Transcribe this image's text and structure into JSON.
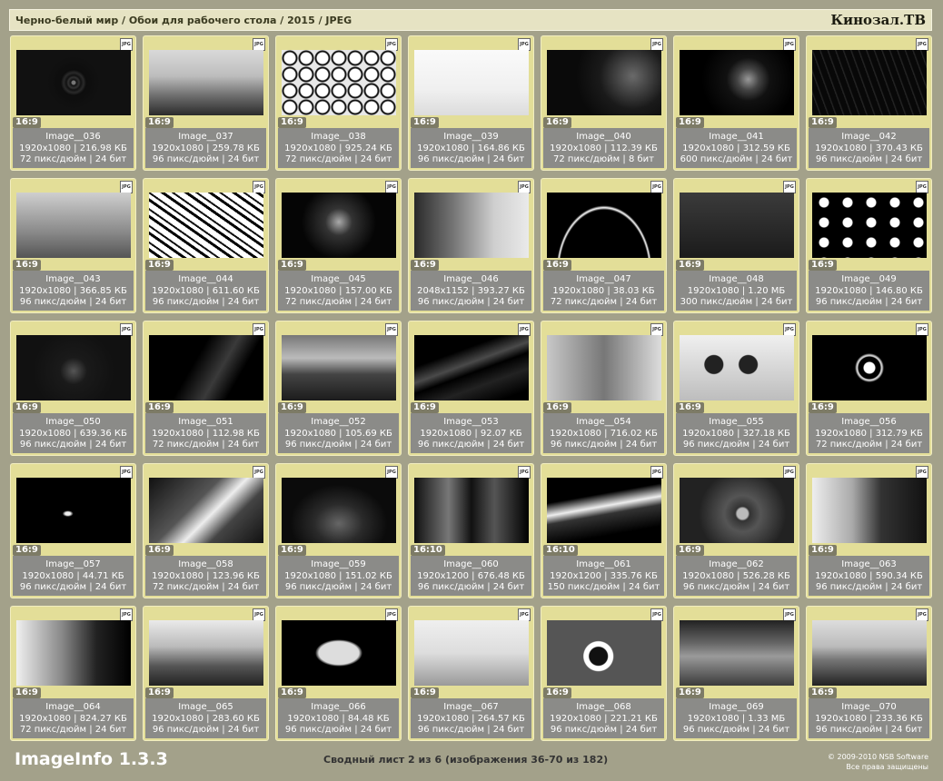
{
  "header": {
    "breadcrumb": "Черно-белый мир / Обои для рабочего стола / 2015 / JPEG",
    "site": "Кинозал.ТВ"
  },
  "badge": "JPG",
  "items": [
    {
      "name": "Image__036",
      "res": "1920x1080",
      "size": "216.98 КБ",
      "dpi": "72 пикс/дюйм",
      "bits": "24 бит",
      "ratio": "16:9"
    },
    {
      "name": "Image__037",
      "res": "1920x1080",
      "size": "259.78 КБ",
      "dpi": "96 пикс/дюйм",
      "bits": "24 бит",
      "ratio": "16:9"
    },
    {
      "name": "Image__038",
      "res": "1920x1080",
      "size": "925.24 КБ",
      "dpi": "72 пикс/дюйм",
      "bits": "24 бит",
      "ratio": "16:9"
    },
    {
      "name": "Image__039",
      "res": "1920x1080",
      "size": "164.86 КБ",
      "dpi": "96 пикс/дюйм",
      "bits": "24 бит",
      "ratio": "16:9"
    },
    {
      "name": "Image__040",
      "res": "1920x1080",
      "size": "112.39 КБ",
      "dpi": "72 пикс/дюйм",
      "bits": "8 бит",
      "ratio": "16:9"
    },
    {
      "name": "Image__041",
      "res": "1920x1080",
      "size": "312.59 КБ",
      "dpi": "600 пикс/дюйм",
      "bits": "24 бит",
      "ratio": "16:9"
    },
    {
      "name": "Image__042",
      "res": "1920x1080",
      "size": "370.43 КБ",
      "dpi": "96 пикс/дюйм",
      "bits": "24 бит",
      "ratio": "16:9"
    },
    {
      "name": "Image__043",
      "res": "1920x1080",
      "size": "366.85 КБ",
      "dpi": "96 пикс/дюйм",
      "bits": "24 бит",
      "ratio": "16:9"
    },
    {
      "name": "Image__044",
      "res": "1920x1080",
      "size": "611.60 КБ",
      "dpi": "96 пикс/дюйм",
      "bits": "24 бит",
      "ratio": "16:9"
    },
    {
      "name": "Image__045",
      "res": "1920x1080",
      "size": "157.00 КБ",
      "dpi": "72 пикс/дюйм",
      "bits": "24 бит",
      "ratio": "16:9"
    },
    {
      "name": "Image__046",
      "res": "2048x1152",
      "size": "393.27 КБ",
      "dpi": "96 пикс/дюйм",
      "bits": "24 бит",
      "ratio": "16:9"
    },
    {
      "name": "Image__047",
      "res": "1920x1080",
      "size": "38.03 КБ",
      "dpi": "72 пикс/дюйм",
      "bits": "24 бит",
      "ratio": "16:9"
    },
    {
      "name": "Image__048",
      "res": "1920x1080",
      "size": "1.20 МБ",
      "dpi": "300 пикс/дюйм",
      "bits": "24 бит",
      "ratio": "16:9"
    },
    {
      "name": "Image__049",
      "res": "1920x1080",
      "size": "146.80 КБ",
      "dpi": "96 пикс/дюйм",
      "bits": "24 бит",
      "ratio": "16:9"
    },
    {
      "name": "Image__050",
      "res": "1920x1080",
      "size": "639.36 КБ",
      "dpi": "96 пикс/дюйм",
      "bits": "24 бит",
      "ratio": "16:9"
    },
    {
      "name": "Image__051",
      "res": "1920x1080",
      "size": "112.98 КБ",
      "dpi": "72 пикс/дюйм",
      "bits": "24 бит",
      "ratio": "16:9"
    },
    {
      "name": "Image__052",
      "res": "1920x1080",
      "size": "105.69 КБ",
      "dpi": "96 пикс/дюйм",
      "bits": "24 бит",
      "ratio": "16:9"
    },
    {
      "name": "Image__053",
      "res": "1920x1080",
      "size": "92.07 КБ",
      "dpi": "96 пикс/дюйм",
      "bits": "24 бит",
      "ratio": "16:9"
    },
    {
      "name": "Image__054",
      "res": "1920x1080",
      "size": "716.02 КБ",
      "dpi": "96 пикс/дюйм",
      "bits": "24 бит",
      "ratio": "16:9"
    },
    {
      "name": "Image__055",
      "res": "1920x1080",
      "size": "327.18 КБ",
      "dpi": "96 пикс/дюйм",
      "bits": "24 бит",
      "ratio": "16:9"
    },
    {
      "name": "Image__056",
      "res": "1920x1080",
      "size": "312.79 КБ",
      "dpi": "72 пикс/дюйм",
      "bits": "24 бит",
      "ratio": "16:9"
    },
    {
      "name": "Image__057",
      "res": "1920x1080",
      "size": "44.71 КБ",
      "dpi": "96 пикс/дюйм",
      "bits": "24 бит",
      "ratio": "16:9"
    },
    {
      "name": "Image__058",
      "res": "1920x1080",
      "size": "123.96 КБ",
      "dpi": "72 пикс/дюйм",
      "bits": "24 бит",
      "ratio": "16:9"
    },
    {
      "name": "Image__059",
      "res": "1920x1080",
      "size": "151.02 КБ",
      "dpi": "96 пикс/дюйм",
      "bits": "24 бит",
      "ratio": "16:9"
    },
    {
      "name": "Image__060",
      "res": "1920x1200",
      "size": "676.48 КБ",
      "dpi": "96 пикс/дюйм",
      "bits": "24 бит",
      "ratio": "16:10"
    },
    {
      "name": "Image__061",
      "res": "1920x1200",
      "size": "335.76 КБ",
      "dpi": "150 пикс/дюйм",
      "bits": "24 бит",
      "ratio": "16:10"
    },
    {
      "name": "Image__062",
      "res": "1920x1080",
      "size": "526.28 КБ",
      "dpi": "96 пикс/дюйм",
      "bits": "24 бит",
      "ratio": "16:9"
    },
    {
      "name": "Image__063",
      "res": "1920x1080",
      "size": "590.34 КБ",
      "dpi": "96 пикс/дюйм",
      "bits": "24 бит",
      "ratio": "16:9"
    },
    {
      "name": "Image__064",
      "res": "1920x1080",
      "size": "824.27 КБ",
      "dpi": "72 пикс/дюйм",
      "bits": "24 бит",
      "ratio": "16:9"
    },
    {
      "name": "Image__065",
      "res": "1920x1080",
      "size": "283.60 КБ",
      "dpi": "96 пикс/дюйм",
      "bits": "24 бит",
      "ratio": "16:9"
    },
    {
      "name": "Image__066",
      "res": "1920x1080",
      "size": "84.48 КБ",
      "dpi": "96 пикс/дюйм",
      "bits": "24 бит",
      "ratio": "16:9"
    },
    {
      "name": "Image__067",
      "res": "1920x1080",
      "size": "264.57 КБ",
      "dpi": "96 пикс/дюйм",
      "bits": "24 бит",
      "ratio": "16:9"
    },
    {
      "name": "Image__068",
      "res": "1920x1080",
      "size": "221.21 КБ",
      "dpi": "96 пикс/дюйм",
      "bits": "24 бит",
      "ratio": "16:9"
    },
    {
      "name": "Image__069",
      "res": "1920x1080",
      "size": "1.33 МБ",
      "dpi": "96 пикс/дюйм",
      "bits": "24 бит",
      "ratio": "16:9"
    },
    {
      "name": "Image__070",
      "res": "1920x1080",
      "size": "233.36 КБ",
      "dpi": "96 пикс/дюйм",
      "bits": "24 бит",
      "ratio": "16:9"
    }
  ],
  "footer": {
    "app": "ImageInfo 1.3.3",
    "summary": "Сводный лист 2 из 6 (изображения 36-70 из 182)",
    "copyright": "© 2009-2010 NSB Software",
    "rights": "Все права защищены"
  }
}
